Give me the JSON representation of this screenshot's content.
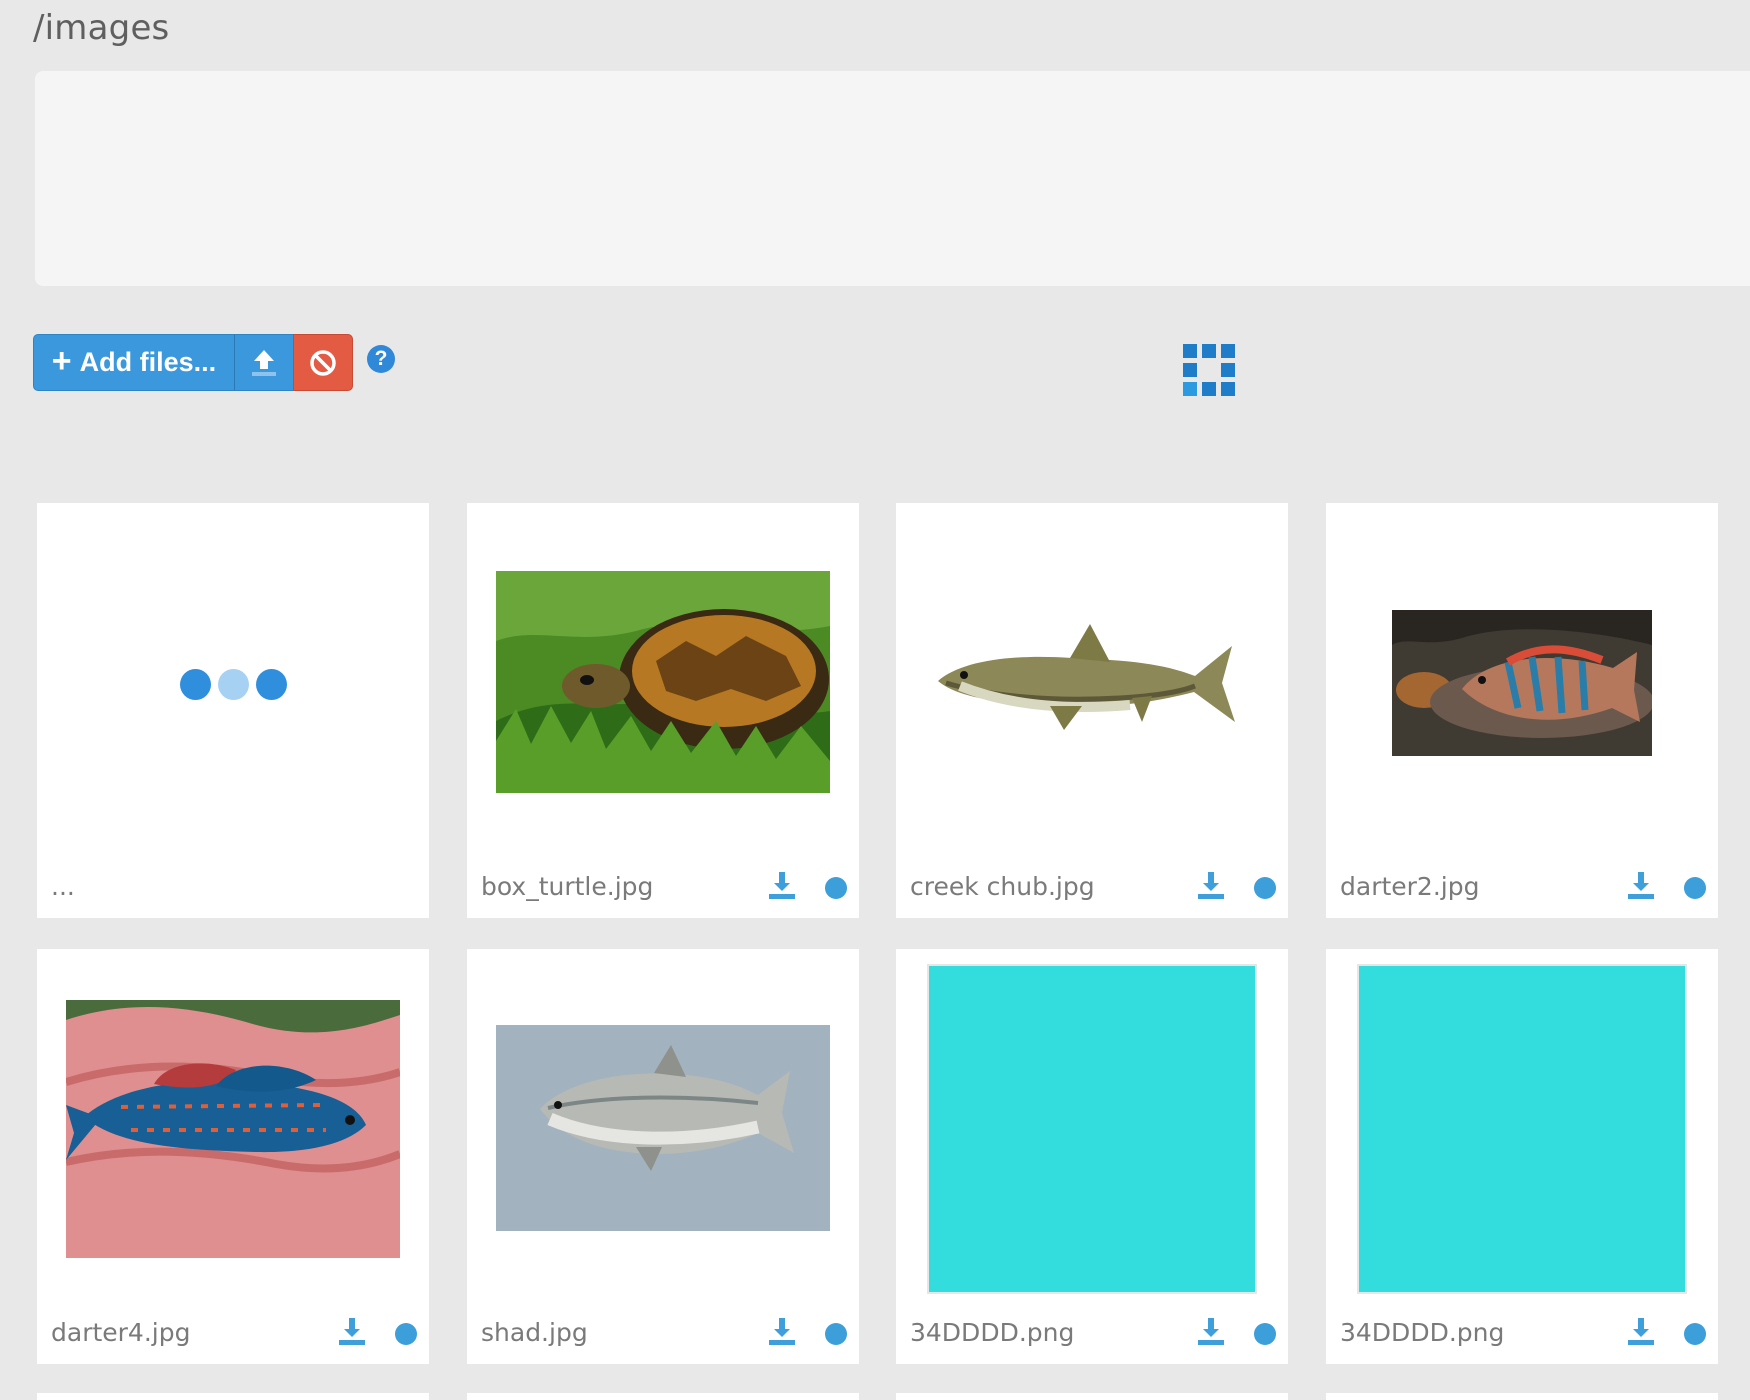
{
  "header": {
    "path": "/images"
  },
  "toolbar": {
    "add_label": "Add files...",
    "upload_icon": "upload-icon",
    "cancel_icon": "cancel-icon",
    "help_icon": "help-icon",
    "view_icon": "grid-view-icon"
  },
  "colors": {
    "primary": "#3b98dd",
    "danger": "#e25b42",
    "status": "#3c9fd9",
    "swatch": "#34DDDD"
  },
  "files": [
    {
      "name": "...",
      "type": "loading"
    },
    {
      "name": "box_turtle.jpg",
      "type": "turtle"
    },
    {
      "name": "creek chub.jpg",
      "type": "chub"
    },
    {
      "name": "darter2.jpg",
      "type": "darter2"
    },
    {
      "name": "darter4.jpg",
      "type": "darter4"
    },
    {
      "name": "shad.jpg",
      "type": "shad"
    },
    {
      "name": "34DDDD.png",
      "type": "swatch"
    },
    {
      "name": "34DDDD.png",
      "type": "swatch"
    }
  ]
}
